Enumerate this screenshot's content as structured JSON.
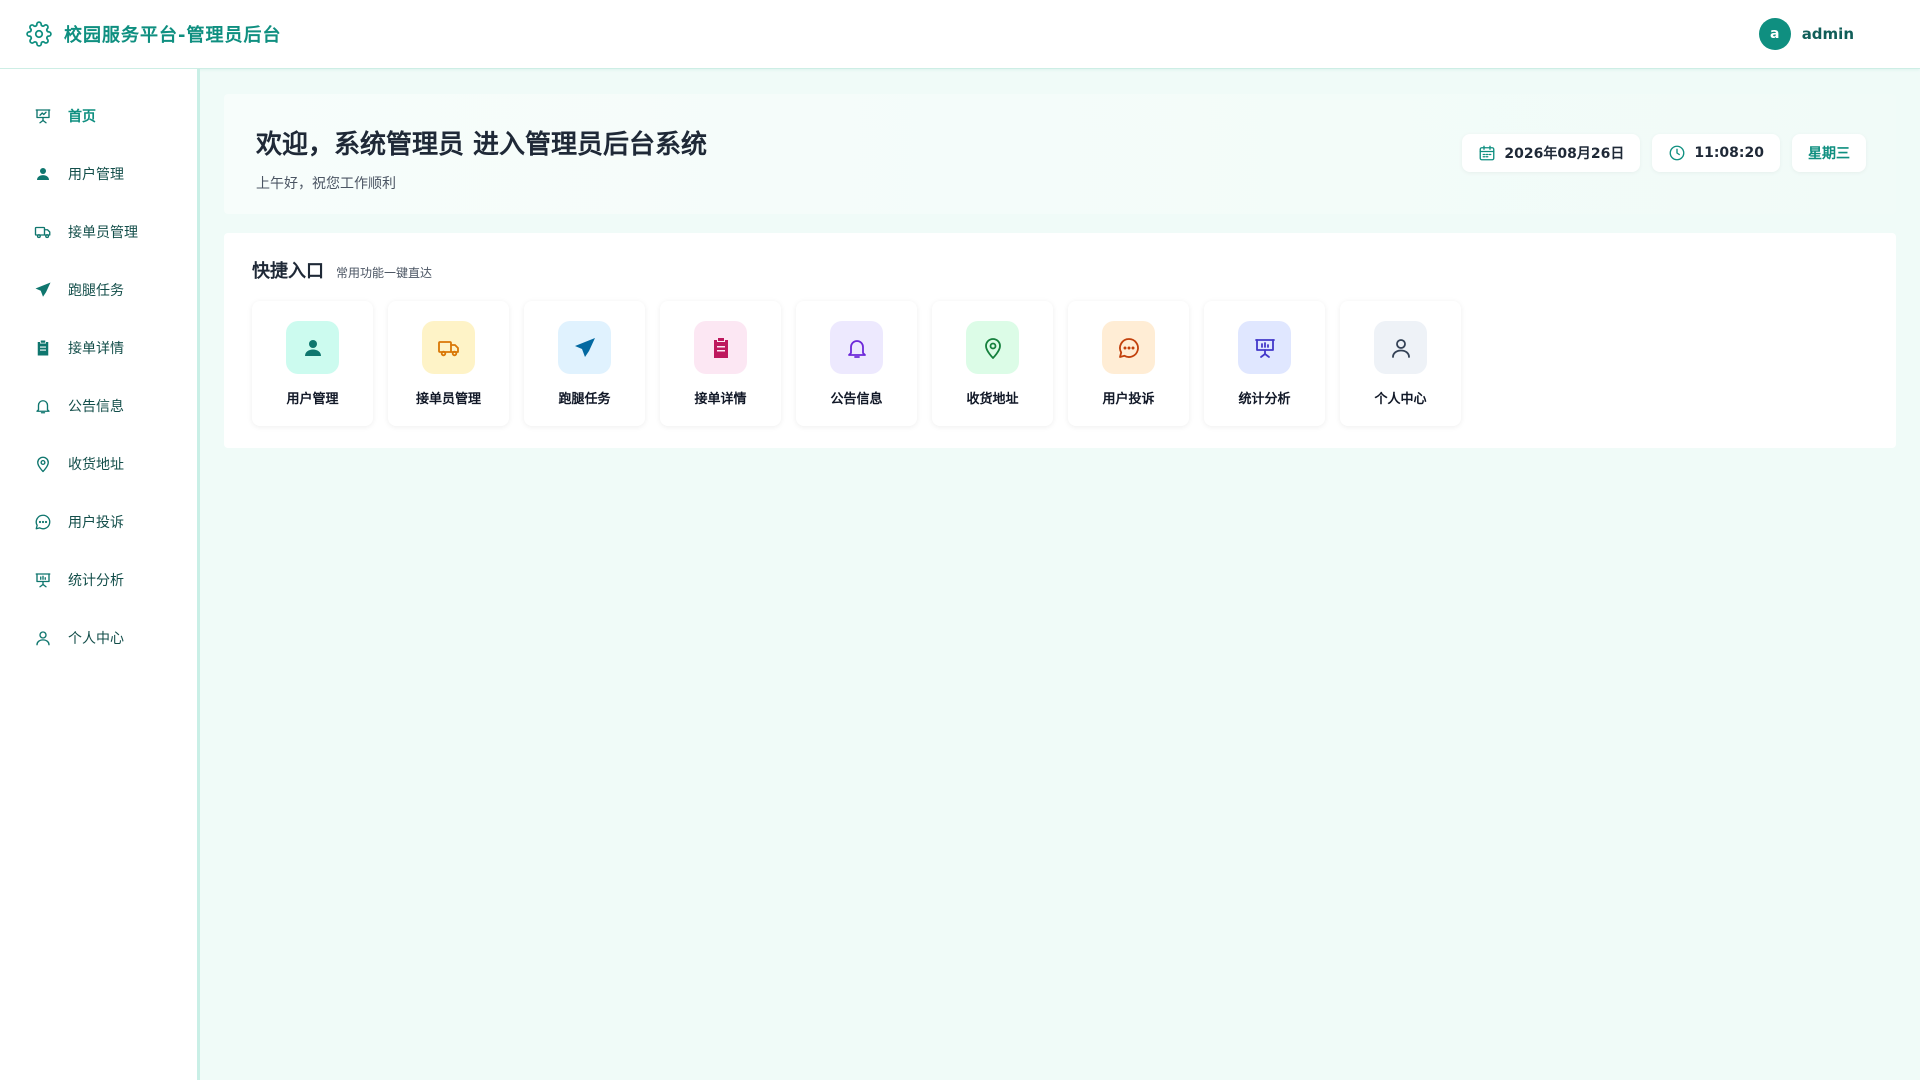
{
  "header": {
    "app_title": "校园服务平台-管理员后台",
    "avatar_letter": "a",
    "username": "admin"
  },
  "sidebar": {
    "items": [
      {
        "label": "首页",
        "icon": "presentation-icon",
        "active": true
      },
      {
        "label": "用户管理",
        "icon": "user-icon"
      },
      {
        "label": "接单员管理",
        "icon": "truck-icon"
      },
      {
        "label": "跑腿任务",
        "icon": "send-icon"
      },
      {
        "label": "接单详情",
        "icon": "clipboard-icon"
      },
      {
        "label": "公告信息",
        "icon": "bell-icon"
      },
      {
        "label": "收货地址",
        "icon": "map-pin-icon"
      },
      {
        "label": "用户投诉",
        "icon": "chat-icon"
      },
      {
        "label": "统计分析",
        "icon": "chart-board-icon"
      },
      {
        "label": "个人中心",
        "icon": "person-icon"
      }
    ]
  },
  "welcome": {
    "title": "欢迎，系统管理员 进入管理员后台系统",
    "greeting": "上午好，祝您工作顺利",
    "date": "2026年08月26日",
    "time": "11:08:20",
    "weekday": "星期三"
  },
  "quick": {
    "title": "快捷入口",
    "subtitle": "常用功能一键直达",
    "items": [
      {
        "label": "用户管理",
        "icon": "user-icon",
        "bg": "#ccfbef",
        "fg": "#0f766e"
      },
      {
        "label": "接单员管理",
        "icon": "truck-icon",
        "bg": "#fef3c7",
        "fg": "#d97706"
      },
      {
        "label": "跑腿任务",
        "icon": "send-icon",
        "bg": "#e0f2fe",
        "fg": "#0369a1"
      },
      {
        "label": "接单详情",
        "icon": "clipboard-icon",
        "bg": "#fce7f3",
        "fg": "#be185d"
      },
      {
        "label": "公告信息",
        "icon": "bell-icon",
        "bg": "#ede9fe",
        "fg": "#6d28d9"
      },
      {
        "label": "收货地址",
        "icon": "map-pin-icon",
        "bg": "#dcfce7",
        "fg": "#15803d"
      },
      {
        "label": "用户投诉",
        "icon": "chat-icon",
        "bg": "#ffedd5",
        "fg": "#c2410c"
      },
      {
        "label": "统计分析",
        "icon": "chart-board-icon",
        "bg": "#e0e7ff",
        "fg": "#4338ca"
      },
      {
        "label": "个人中心",
        "icon": "person-icon",
        "bg": "#eef2f7",
        "fg": "#334155"
      }
    ]
  },
  "colors": {
    "accent": "#0f8f80",
    "page_bg": "#f0fbf8"
  }
}
